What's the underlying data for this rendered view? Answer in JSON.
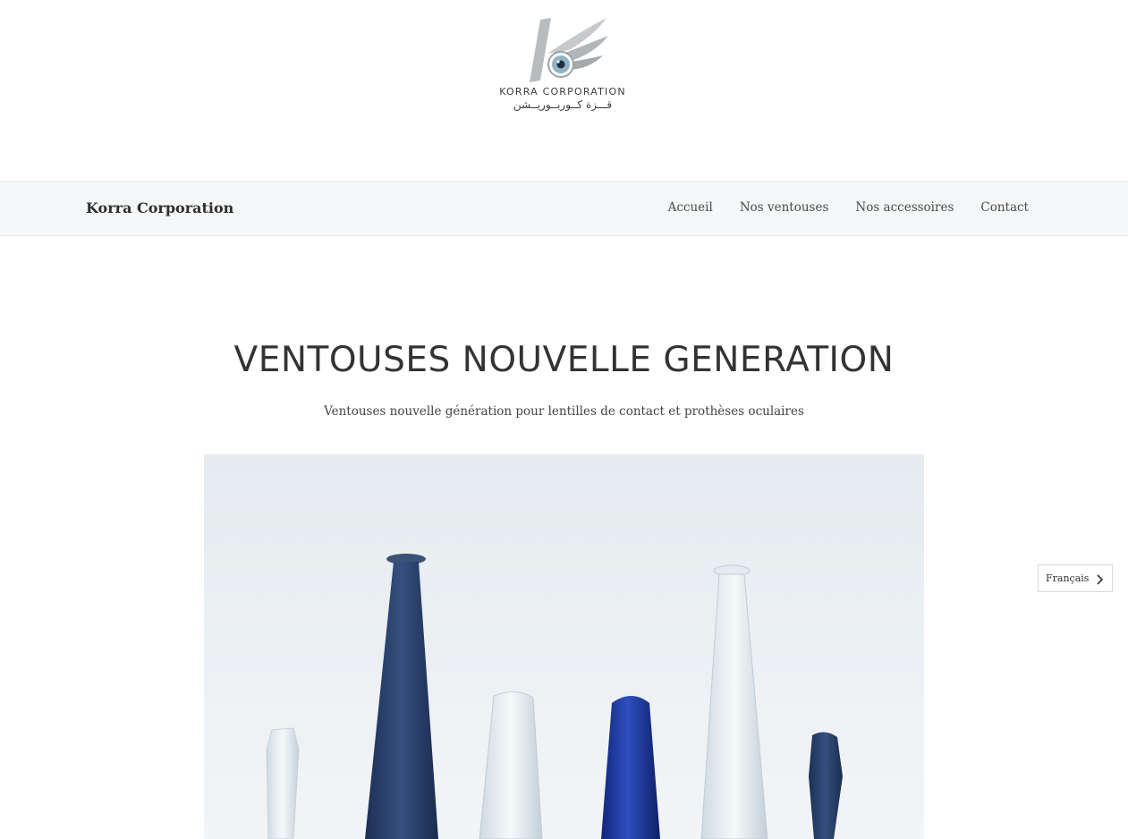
{
  "logo": {
    "latin_text": "KORRA CORPORATION",
    "arabic_text": "قـــزة كــوربــوريــشن"
  },
  "navbar": {
    "brand": "Korra Corporation",
    "links": [
      "Accueil",
      "Nos ventouses",
      "Nos accessoires",
      "Contact"
    ]
  },
  "hero": {
    "title": "VENTOUSES NOUVELLE GENERATION",
    "subtitle": "Ventouses nouvelle génération pour lentilles de contact et prothèses oculaires"
  },
  "language_selector": {
    "label": "Français"
  },
  "colors": {
    "navbar_bg": "#f5f7f8",
    "text_dark": "#333333",
    "product_blue": "#1f3f8f",
    "product_clear": "#dfe7ee"
  }
}
